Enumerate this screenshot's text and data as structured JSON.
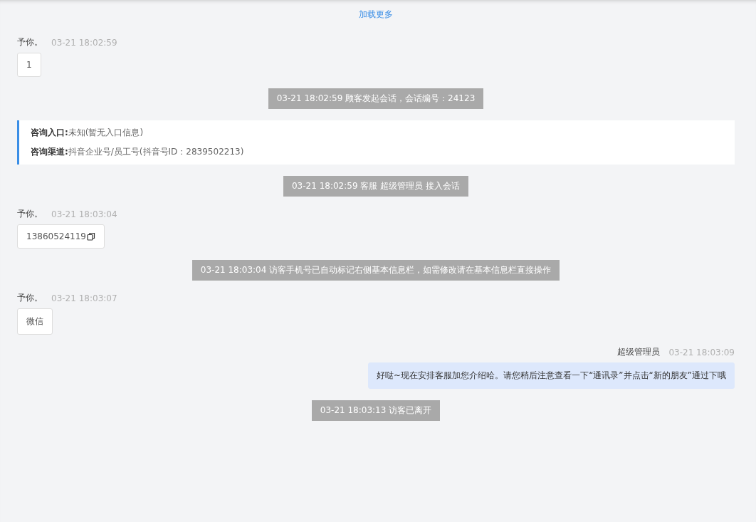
{
  "load_more": "加载更多",
  "messages": [
    {
      "kind": "visitor",
      "sender": "予你。",
      "time": "03-21 18:02:59",
      "text": "1",
      "copyable": false
    },
    {
      "kind": "system",
      "text": "03-21 18:02:59 顾客发起会话，会话编号：24123"
    },
    {
      "kind": "info",
      "lines": [
        {
          "label": "咨询入口:",
          "value": "未知(暂无入口信息)"
        },
        {
          "label": "咨询渠道:",
          "value": "抖音企业号/员工号(抖音号ID：2839502213)"
        }
      ]
    },
    {
      "kind": "system",
      "text": "03-21 18:02:59 客服 超级管理员 接入会话"
    },
    {
      "kind": "visitor",
      "sender": "予你。",
      "time": "03-21 18:03:04",
      "text": "13860524119",
      "copyable": true
    },
    {
      "kind": "system",
      "text": "03-21 18:03:04 访客手机号已自动标记右侧基本信息栏，如需修改请在基本信息栏直接操作"
    },
    {
      "kind": "visitor",
      "sender": "予你。",
      "time": "03-21 18:03:07",
      "text": "微信",
      "copyable": false
    },
    {
      "kind": "agent",
      "sender": "超级管理员",
      "time": "03-21 18:03:09",
      "text": "好哒~现在安排客服加您介绍哈。请您稍后注意查看一下“通讯录”并点击“新的朋友”通过下哦"
    },
    {
      "kind": "system",
      "text": "03-21 18:03:13 访客已离开"
    }
  ]
}
